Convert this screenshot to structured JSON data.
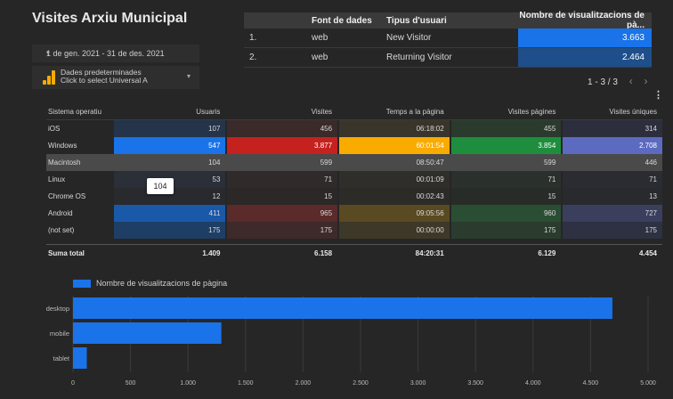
{
  "title": "Visites Arxiu Municipal",
  "date_range": "1 de gen. 2021 - 31 de des. 2021",
  "data_source": {
    "line1": "Dades predeterminades",
    "line2": "Click to select Universal A"
  },
  "source_table": {
    "headers": [
      "Font de dades",
      "Tipus d'usuari",
      "Nombre de visualitzacions de pà..."
    ],
    "rows": [
      {
        "idx": "1.",
        "source": "web",
        "type": "New Visitor",
        "views": "3.663",
        "color": "#1a73e8"
      },
      {
        "idx": "2.",
        "source": "web",
        "type": "Returning Visitor",
        "views": "2.464",
        "color": "#1e4f8a"
      }
    ]
  },
  "pager": {
    "text": "1 - 3 / 3",
    "prev": "‹",
    "next": "›"
  },
  "main_table": {
    "headers": [
      "Sistema operatiu",
      "Usuaris",
      "Visites",
      "Temps a la pàgina",
      "Visites pàgines",
      "Visites úniques"
    ],
    "rows": [
      {
        "os": "iOS",
        "users": "107",
        "visits": "456",
        "time": "06:18:02",
        "pages": "455",
        "unique": "314",
        "bg": [
          "#24344a",
          "#3a2a2a",
          "#3a352a",
          "#2a3a2c",
          "#2c2e3e"
        ]
      },
      {
        "os": "Windows",
        "users": "547",
        "visits": "3.877",
        "time": "60:01:54",
        "pages": "3.854",
        "unique": "2.708",
        "bg": [
          "#1a73e8",
          "#c5221f",
          "#f9ab00",
          "#1e8e3e",
          "#5c6bc0"
        ]
      },
      {
        "os": "Macintosh",
        "users": "104",
        "visits": "599",
        "time": "08:50:47",
        "pages": "599",
        "unique": "446",
        "bg": [
          "#4a4a4a",
          "#4a4a4a",
          "#4a4a4a",
          "#4a4a4a",
          "#4a4a4a"
        ]
      },
      {
        "os": "Linux",
        "users": "53",
        "visits": "71",
        "time": "00:01:09",
        "pages": "71",
        "unique": "71",
        "bg": [
          "#2a2f38",
          "#302a2a",
          "#302e2a",
          "#2a302b",
          "#2b2c32"
        ]
      },
      {
        "os": "Chrome OS",
        "users": "12",
        "visits": "15",
        "time": "00:02:43",
        "pages": "15",
        "unique": "13",
        "bg": [
          "#282a2e",
          "#2c2828",
          "#2c2b28",
          "#282c29",
          "#292a2e"
        ]
      },
      {
        "os": "Android",
        "users": "411",
        "visits": "965",
        "time": "09:05:56",
        "pages": "960",
        "unique": "727",
        "bg": [
          "#1a58a8",
          "#5a2b2a",
          "#5a4a22",
          "#2a4e34",
          "#3b3f5e"
        ]
      },
      {
        "os": "(not set)",
        "users": "175",
        "visits": "175",
        "time": "00:00:00",
        "pages": "175",
        "unique": "175",
        "bg": [
          "#1e3e66",
          "#3e2a2a",
          "#3e3828",
          "#2a3c2e",
          "#2e3142"
        ]
      }
    ],
    "total": {
      "label": "Suma total",
      "users": "1.409",
      "visits": "6.158",
      "time": "84:20:31",
      "pages": "6.129",
      "unique": "4.454"
    },
    "tooltip": "104"
  },
  "chart_data": {
    "type": "bar",
    "orientation": "horizontal",
    "legend": "Nombre de visualitzacions de pàgina",
    "categories": [
      "desktop",
      "mobile",
      "tablet"
    ],
    "values": [
      4690,
      1290,
      120
    ],
    "xlim": [
      0,
      5000
    ],
    "ticks": [
      "0",
      "500",
      "1.000",
      "1.500",
      "2.000",
      "2.500",
      "3.000",
      "3.500",
      "4.000",
      "4.500",
      "5.000"
    ],
    "color": "#1a73e8",
    "grid": true
  }
}
